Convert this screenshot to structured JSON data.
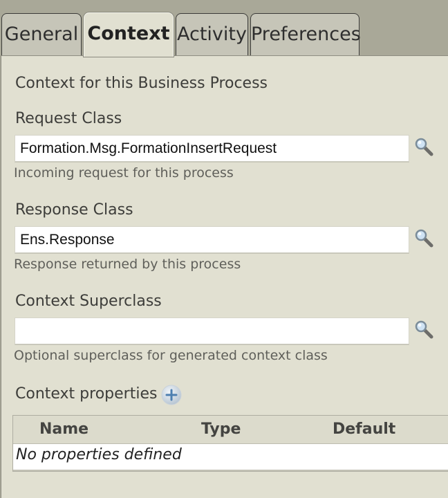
{
  "tabs": {
    "general": "General",
    "context": "Context",
    "activity": "Activity",
    "preferences": "Preferences"
  },
  "panel": {
    "title": "Context for this Business Process",
    "request_class": {
      "label": "Request Class",
      "value": "Formation.Msg.FormationInsertRequest",
      "hint": "Incoming request for this process"
    },
    "response_class": {
      "label": "Response Class",
      "value": "Ens.Response",
      "hint": "Response returned by this process"
    },
    "context_superclass": {
      "label": "Context Superclass",
      "value": "",
      "hint": "Optional superclass for generated context class"
    },
    "context_properties": {
      "label": "Context properties",
      "columns": [
        "Name",
        "Type",
        "Default"
      ],
      "empty_text": "No properties defined"
    }
  },
  "icons": {
    "search": "magnifier-icon",
    "add": "plus-circle-icon"
  },
  "colors": {
    "panel_bg": "#e1e0d1",
    "tab_bg": "#c6c5b8",
    "frame_bg": "#a9a898"
  }
}
